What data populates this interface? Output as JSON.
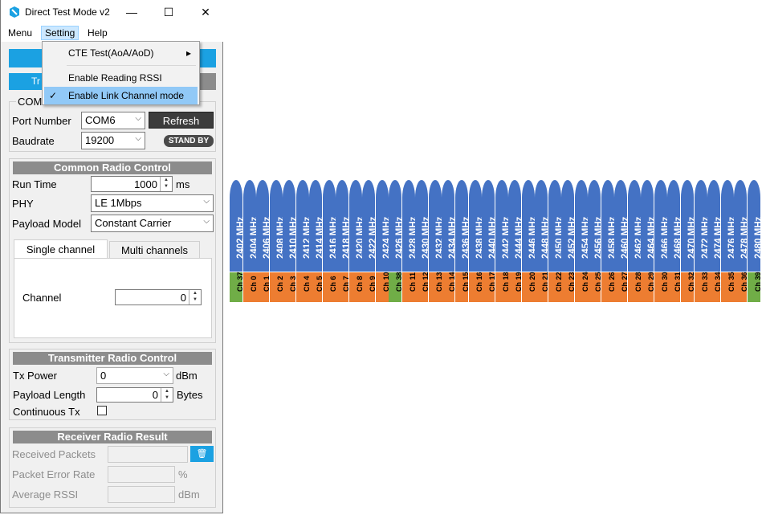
{
  "window": {
    "title": "Direct Test Mode v2",
    "min": "—",
    "max": "☐",
    "close": "✕"
  },
  "menubar": [
    "Menu",
    "Setting",
    "Help"
  ],
  "dropdown": {
    "items": [
      "CTE Test(AoA/AoD)",
      "Enable Reading RSSI",
      "Enable Link Channel mode"
    ],
    "checked_mark": "✓",
    "submenu_arrow": "▸"
  },
  "partial": {
    "blue_tab": "Tr",
    "com_group": "COM"
  },
  "com": {
    "port_label": "Port Number",
    "port_value": "COM6",
    "refresh": "Refresh",
    "baud_label": "Baudrate",
    "baud_value": "19200",
    "status": "STAND BY"
  },
  "common": {
    "header": "Common Radio Control",
    "run_time_label": "Run Time",
    "run_time_value": "1000",
    "run_time_unit": "ms",
    "phy_label": "PHY",
    "phy_value": "LE 1Mbps",
    "payload_model_label": "Payload Model",
    "payload_model_value": "Constant Carrier"
  },
  "tabs": {
    "single": "Single channel",
    "multi": "Multi channels",
    "channel_label": "Channel",
    "channel_value": "0"
  },
  "tx": {
    "header": "Transmitter Radio Control",
    "power_label": "Tx Power",
    "power_value": "0",
    "power_unit": "dBm",
    "payload_len_label": "Payload Length",
    "payload_len_value": "0",
    "payload_len_unit": "Bytes",
    "continuous_label": "Continuous Tx"
  },
  "rx": {
    "header": "Receiver Radio Result",
    "received_label": "Received Packets",
    "per_label": "Packet Error Rate",
    "per_unit": "%",
    "rssi_label": "Average RSSI",
    "rssi_unit": "dBm",
    "trash_icon": "🗑"
  },
  "colors": {
    "accent": "#1ba1e2",
    "freq": "#4472c4",
    "data_channel": "#ed7d31",
    "adv_channel": "#70ad47"
  },
  "channel_map": [
    {
      "freq": "2402 MHz",
      "ch": "Ch 37",
      "adv": true
    },
    {
      "freq": "2404 MHz",
      "ch": "Ch 0",
      "adv": false
    },
    {
      "freq": "2406 MHz",
      "ch": "Ch 1",
      "adv": false
    },
    {
      "freq": "2408 MHz",
      "ch": "Ch 2",
      "adv": false
    },
    {
      "freq": "2410 MHz",
      "ch": "Ch 3",
      "adv": false
    },
    {
      "freq": "2412 MHz",
      "ch": "Ch 4",
      "adv": false
    },
    {
      "freq": "2414 MHz",
      "ch": "Ch 5",
      "adv": false
    },
    {
      "freq": "2416 MHz",
      "ch": "Ch 6",
      "adv": false
    },
    {
      "freq": "2418 MHz",
      "ch": "Ch 7",
      "adv": false
    },
    {
      "freq": "2420 MHz",
      "ch": "Ch 8",
      "adv": false
    },
    {
      "freq": "2422 MHz",
      "ch": "Ch 9",
      "adv": false
    },
    {
      "freq": "2424 MHz",
      "ch": "Ch 10",
      "adv": false
    },
    {
      "freq": "2426 MHz",
      "ch": "Ch 38",
      "adv": true
    },
    {
      "freq": "2428 MHz",
      "ch": "Ch 11",
      "adv": false
    },
    {
      "freq": "2430 MHz",
      "ch": "Ch 12",
      "adv": false
    },
    {
      "freq": "2432 MHz",
      "ch": "Ch 13",
      "adv": false
    },
    {
      "freq": "2434 MHz",
      "ch": "Ch 14",
      "adv": false
    },
    {
      "freq": "2436 MHz",
      "ch": "Ch 15",
      "adv": false
    },
    {
      "freq": "2438 MHz",
      "ch": "Ch 16",
      "adv": false
    },
    {
      "freq": "2440 MHz",
      "ch": "Ch 17",
      "adv": false
    },
    {
      "freq": "2442 MHz",
      "ch": "Ch 18",
      "adv": false
    },
    {
      "freq": "2444 MHz",
      "ch": "Ch 19",
      "adv": false
    },
    {
      "freq": "2446 MHz",
      "ch": "Ch 20",
      "adv": false
    },
    {
      "freq": "2448 MHz",
      "ch": "Ch 21",
      "adv": false
    },
    {
      "freq": "2450 MHz",
      "ch": "Ch 22",
      "adv": false
    },
    {
      "freq": "2452 MHz",
      "ch": "Ch 23",
      "adv": false
    },
    {
      "freq": "2454 MHz",
      "ch": "Ch 24",
      "adv": false
    },
    {
      "freq": "2456 MHz",
      "ch": "Ch 25",
      "adv": false
    },
    {
      "freq": "2458 MHz",
      "ch": "Ch 26",
      "adv": false
    },
    {
      "freq": "2460 MHz",
      "ch": "Ch 27",
      "adv": false
    },
    {
      "freq": "2462 MHz",
      "ch": "Ch 28",
      "adv": false
    },
    {
      "freq": "2464 MHz",
      "ch": "Ch 29",
      "adv": false
    },
    {
      "freq": "2466 MHz",
      "ch": "Ch 30",
      "adv": false
    },
    {
      "freq": "2468 MHz",
      "ch": "Ch 31",
      "adv": false
    },
    {
      "freq": "2470 MHz",
      "ch": "Ch 32",
      "adv": false
    },
    {
      "freq": "2472 MHz",
      "ch": "Ch 33",
      "adv": false
    },
    {
      "freq": "2474 MHz",
      "ch": "Ch 34",
      "adv": false
    },
    {
      "freq": "2476 MHz",
      "ch": "Ch 35",
      "adv": false
    },
    {
      "freq": "2478 MHz",
      "ch": "Ch 36",
      "adv": false
    },
    {
      "freq": "2480 MHz",
      "ch": "Ch 39",
      "adv": true
    }
  ]
}
